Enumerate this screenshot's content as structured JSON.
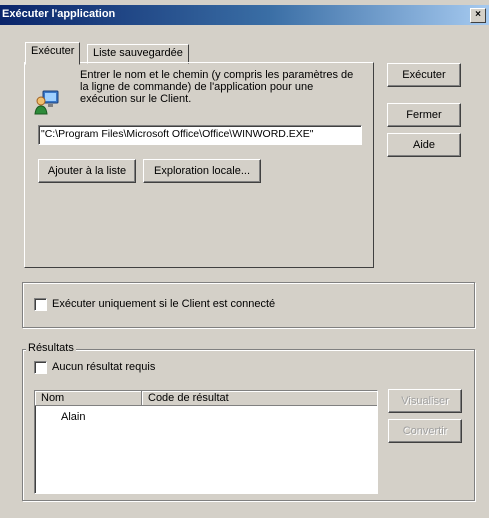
{
  "window": {
    "title": "Exécuter l'application",
    "close_glyph": "×"
  },
  "tabs": [
    {
      "label": "Exécuter"
    },
    {
      "label": "Liste sauvegardée"
    }
  ],
  "run_tab": {
    "instructions_line1": "Entrer le nom et le chemin (y compris les paramètres de",
    "instructions_line2": "la ligne de commande) de l'application pour une",
    "instructions_line3": "exécution sur le Client.",
    "command_value": "\"C:\\Program Files\\Microsoft Office\\Office\\WINWORD.EXE\"",
    "add_to_list_label": "Ajouter à la liste",
    "browse_local_label": "Exploration locale..."
  },
  "side_buttons": {
    "run": "Exécuter",
    "close": "Fermer",
    "help": "Aide"
  },
  "options": {
    "run_only_if_connected": {
      "label": "Exécuter uniquement si le Client est connecté",
      "checked": false
    }
  },
  "results": {
    "legend": "Résultats",
    "no_result_required": {
      "label": "Aucun résultat requis",
      "checked": false
    },
    "columns": [
      "Nom",
      "Code de résultat"
    ],
    "rows": [
      {
        "name": "Alain",
        "code": ""
      }
    ],
    "view_label": "Visualiser",
    "convert_label": "Convertir"
  },
  "icons": {
    "app_icon": "computer-user-icon"
  }
}
